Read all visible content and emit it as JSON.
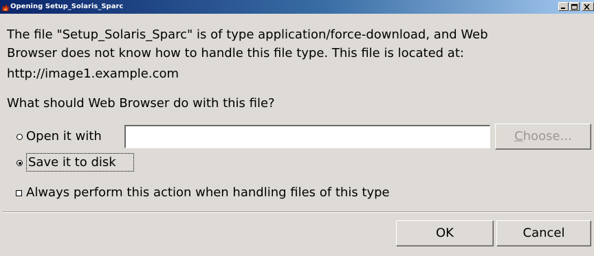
{
  "window": {
    "title": "Opening Setup_Solaris_Sparc",
    "icon": "fox-app-icon",
    "controls": [
      "minimize-icon",
      "maximize-icon",
      "close-icon"
    ]
  },
  "message": {
    "line1": "The file \"Setup_Solaris_Sparc\" is of type application/force-download, and Web",
    "line2": "Browser does not know how to handle this file type. This file is located at:",
    "location": "http://image1.example.com"
  },
  "question": "What should Web Browser do with this file?",
  "options": {
    "open_with": {
      "label": "Open it with",
      "selected": false,
      "app_value": ""
    },
    "choose_button": {
      "mnemonic": "C",
      "rest": "hoose...",
      "enabled": false
    },
    "save_to_disk": {
      "label": "Save it to disk",
      "selected": true
    }
  },
  "always": {
    "label": "Always perform this action when handling files of this type",
    "checked": false
  },
  "buttons": {
    "ok": "OK",
    "cancel": "Cancel"
  },
  "colors": {
    "background": "#dedbd6",
    "titlebar_start": "#0a246a",
    "titlebar_end": "#a6caf0",
    "disabled_text": "#9a9792"
  }
}
